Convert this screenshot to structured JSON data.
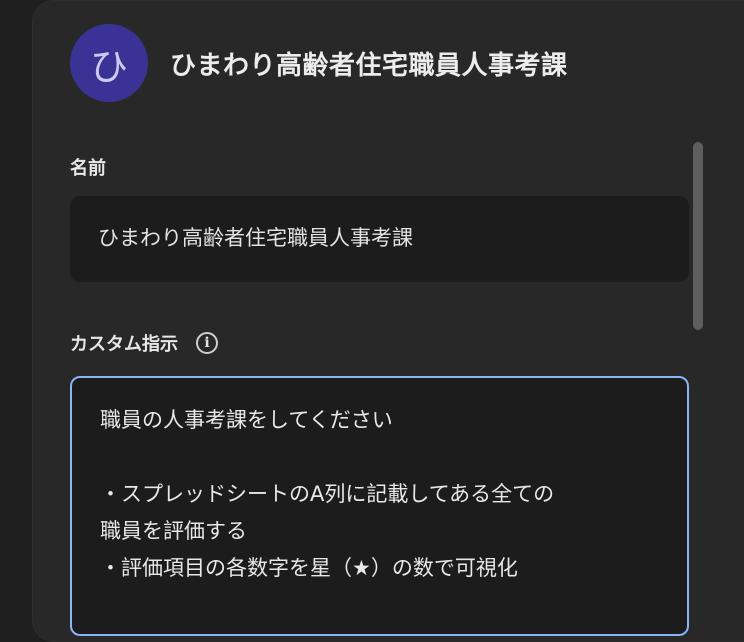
{
  "header": {
    "avatar_initial": "ひ",
    "avatar_color": "#3b3295",
    "title": "ひまわり高齢者住宅職員人事考課"
  },
  "name_section": {
    "label": "名前",
    "value": "ひまわり高齢者住宅職員人事考課"
  },
  "custom_instructions": {
    "label": "カスタム指示",
    "info_icon": "info-icon",
    "border_color": "#8ab4f8",
    "lines": [
      "職員の人事考課をしてください",
      "",
      "・スプレッドシートのA列に記載してある全ての",
      "職員を評価する",
      "・評価項目の各数字を星（★）の数で可視化"
    ]
  }
}
